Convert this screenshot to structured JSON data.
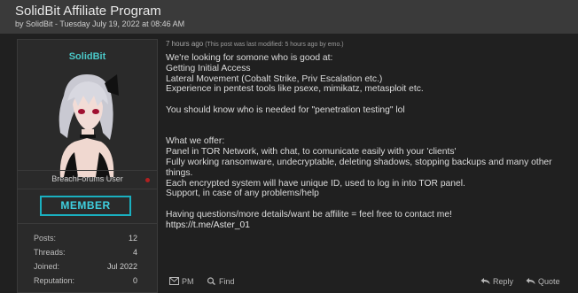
{
  "thread": {
    "title": "SolidBit Affiliate Program",
    "byline": "by SolidBit - Tuesday July 19, 2022 at 08:46 AM"
  },
  "user": {
    "name": "SolidBit",
    "role": "BreachForums User",
    "badge": "MEMBER",
    "stats": [
      {
        "label": "Posts:",
        "value": "12"
      },
      {
        "label": "Threads:",
        "value": "4"
      },
      {
        "label": "Joined:",
        "value": "Jul 2022"
      },
      {
        "label": "Reputation:",
        "value": "0"
      }
    ]
  },
  "post": {
    "timestamp": "7 hours ago",
    "modified": "(This post was last modified: 5 hours ago by emo.)",
    "lines": [
      "We're looking for somone who is good at:",
      "Getting Initial Access",
      "Lateral Movement (Cobalt Strike, Priv Escalation etc.)",
      "Experience in pentest tools like psexe, mimikatz, metasploit etc.",
      "",
      "You should know who is needed for \"penetration testing\" lol",
      "",
      "",
      "What we offer:",
      "Panel in TOR Network, with chat, to comunicate easily with your 'clients'",
      "Fully working ransomware, undecryptable, deleting shadows, stopping backups and many other things.",
      "Each encrypted system will have unique ID, used to log in into TOR panel.",
      "Support, in case of any problems/help",
      "",
      "Having questions/more details/want be affilite = feel free to contact me!",
      "https://t.me/Aster_01"
    ]
  },
  "footer": {
    "pm": "PM",
    "find": "Find",
    "reply": "Reply",
    "quote": "Quote"
  },
  "colors": {
    "accent": "#4ac8c8",
    "badge_border": "#1ab0c0",
    "status_dot": "#b02020"
  }
}
